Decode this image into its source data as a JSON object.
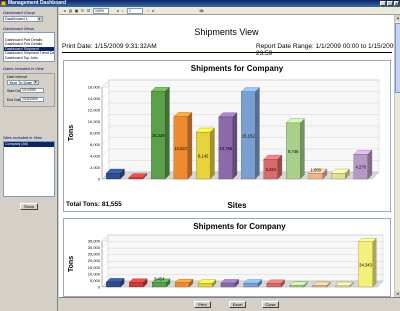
{
  "window": {
    "title": "Management Dashboard"
  },
  "left": {
    "group_label": "Dashboard Group",
    "group_value": "Dashboard 1",
    "views_label": "Dashboard Views",
    "views": [
      {
        "label": "",
        "selected": false
      },
      {
        "label": "Dashboard Port Details",
        "selected": false
      },
      {
        "label": "Dashboard Port Details",
        "selected": false
      },
      {
        "label": "Dashboard Shipment",
        "selected": true
      },
      {
        "label": "Dashboard Shipment Trend Daily",
        "selected": false
      },
      {
        "label": "Dashboard Top Jobs",
        "selected": false
      }
    ],
    "dates_label": "Dates Included in View",
    "date_interval_label": "Date Interval",
    "date_interval_value": "Year To Date",
    "start_label": "Start Date",
    "start_value": "1/1/2009",
    "end_label": "End Date",
    "end_value": "1/15/2009",
    "sites_label": "Sites Included in View",
    "sites": [
      {
        "label": "Company (All)",
        "selected": true
      },
      {
        "label": "",
        "selected": false
      },
      {
        "label": "",
        "selected": false
      },
      {
        "label": "",
        "selected": false
      },
      {
        "label": "",
        "selected": false
      },
      {
        "label": "",
        "selected": false
      },
      {
        "label": "",
        "selected": false
      },
      {
        "label": "",
        "selected": false
      },
      {
        "label": "",
        "selected": false
      },
      {
        "label": "",
        "selected": false
      },
      {
        "label": "",
        "selected": false
      },
      {
        "label": "",
        "selected": false
      }
    ],
    "show_button": "Show"
  },
  "toolbar": {
    "page_value": "1",
    "zoom_value": "100%"
  },
  "report": {
    "title": "Shipments View",
    "print_date": "Print Date: 1/15/2009    9:31:32AM",
    "range": "Report Date Range: 1/1/2009 00:00 to 1/15/2009 23:59",
    "total": "Total Tons: 81,555"
  },
  "buttons": {
    "print": "Print",
    "export": "Excel",
    "close": "Close"
  },
  "colors": {
    "bar1": "#2f4e8c",
    "bar2": "#cc3a3a",
    "bar3": "#5aa04a",
    "bar4": "#f08a30",
    "bar5": "#e6d23a",
    "bar6": "#8a6aa8",
    "bar7": "#7a9fd0",
    "bar8": "#d86a6a",
    "bar9": "#a8d08a",
    "bar10": "#f0b48a",
    "bar11": "#e0e090",
    "bar12": "#b898c8",
    "tall": "#f4f07a"
  },
  "chart_data": [
    {
      "type": "bar",
      "title": "Shipments for Company",
      "xlabel": "Sites",
      "ylabel": "Tons",
      "ylim": [
        0,
        16000
      ],
      "yticks": [
        "0",
        "2,000",
        "4,000",
        "6,000",
        "8,000",
        "10,000",
        "12,000",
        "14,000",
        "16,000"
      ],
      "categories": [
        "",
        "",
        "",
        "",
        "",
        "",
        "",
        "",
        "",
        "",
        "",
        ""
      ],
      "values": [
        1000,
        200,
        15229,
        10827,
        8142,
        10785,
        15152,
        3424,
        9746,
        1000,
        1000,
        4276
      ],
      "labels": [
        "",
        "",
        "15,229",
        "10,827",
        "8,142",
        "10,785",
        "15,152",
        "3,424",
        "9,746",
        "1,000",
        "",
        "4,276"
      ]
    },
    {
      "type": "bar",
      "title": "Shipments for Company",
      "xlabel": "",
      "ylabel": "Tons",
      "ylim": [
        0,
        35000
      ],
      "yticks": [
        "0",
        "5,000",
        "10,000",
        "15,000",
        "20,000",
        "25,000",
        "30,000",
        "35,000"
      ],
      "categories": [
        "",
        "",
        "",
        "",
        "",
        "",
        "",
        "",
        "",
        "",
        "",
        ""
      ],
      "values": [
        3800,
        3500,
        3454,
        3200,
        2800,
        3000,
        2900,
        2700,
        1200,
        1100,
        1000,
        34343
      ],
      "labels": [
        "",
        "",
        "3,454",
        "",
        "",
        "",
        "",
        "",
        "",
        "",
        "",
        "34,343"
      ]
    }
  ]
}
